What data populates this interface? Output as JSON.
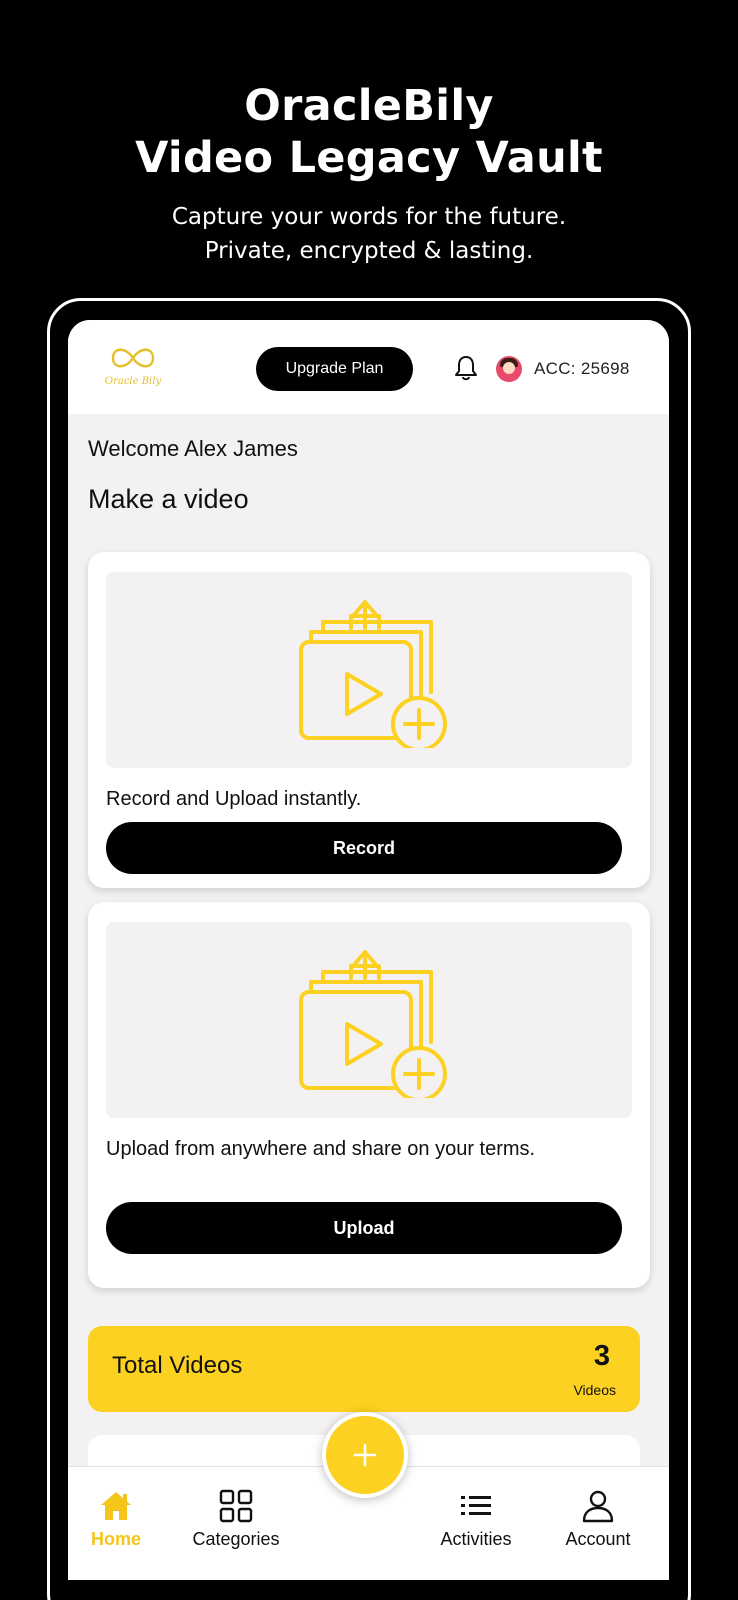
{
  "promo": {
    "title_line1": "OracleBily",
    "title_line2": "Video Legacy Vault",
    "subtitle_line1": "Capture your words for the future.",
    "subtitle_line2": "Private, encrypted & lasting."
  },
  "header": {
    "logo_text": "Oracle Bily",
    "upgrade_label": "Upgrade Plan",
    "account_label": "ACC: 25698"
  },
  "main": {
    "welcome": "Welcome Alex James",
    "section_title": "Make a video",
    "cards": [
      {
        "description": "Record and Upload instantly.",
        "button_label": "Record",
        "icon": "video-upload-icon"
      },
      {
        "description": "Upload from anywhere and share on your terms.",
        "button_label": "Upload",
        "icon": "video-upload-icon"
      }
    ],
    "total_videos": {
      "label": "Total Videos",
      "count": "3",
      "unit": "Videos"
    }
  },
  "nav": {
    "items": [
      {
        "label": "Home",
        "icon": "home-icon",
        "active": true
      },
      {
        "label": "Categories",
        "icon": "grid-icon",
        "active": false
      },
      {
        "label": "Activities",
        "icon": "list-icon",
        "active": false
      },
      {
        "label": "Account",
        "icon": "user-icon",
        "active": false
      }
    ],
    "fab_icon": "plus-icon"
  },
  "colors": {
    "accent": "#fcd121",
    "accent_text": "#f4c61b",
    "button": "#000000",
    "background": "#f3f1f1"
  }
}
